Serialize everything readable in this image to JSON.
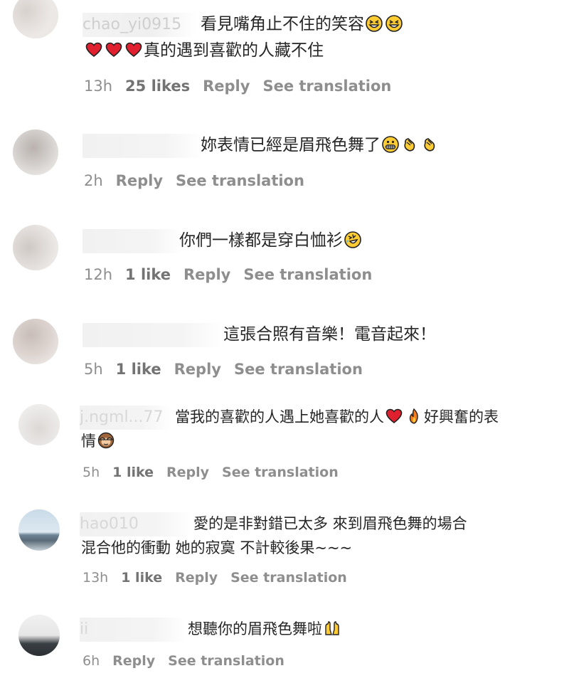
{
  "comments": [
    {
      "username": "chao_yi0915",
      "line1": "看見嘴角止不住的笑容",
      "line2": "真的遇到喜歡的人藏不住",
      "time": "13h",
      "likes": "25 likes",
      "reply": "Reply",
      "translate": "See translation"
    },
    {
      "username": "",
      "line1": "妳表情已經是眉飛色舞了",
      "time": "2h",
      "reply": "Reply",
      "translate": "See translation"
    },
    {
      "username": "",
      "line1": "你們一樣都是穿白恤衫",
      "time": "12h",
      "likes": "1 like",
      "reply": "Reply",
      "translate": "See translation"
    },
    {
      "username": "",
      "line1": "這張合照有音樂！電音起來！",
      "time": "5h",
      "likes": "1 like",
      "reply": "Reply",
      "translate": "See translation"
    },
    {
      "username": "j.ngml...77",
      "line1a": "當我的喜歡的人遇上她喜歡的人",
      "line1b": "好興奮的表",
      "line2": "情",
      "time": "5h",
      "likes": "1 like",
      "reply": "Reply",
      "translate": "See translation"
    },
    {
      "username": "hao010",
      "line1": "愛的是非對錯已太多 來到眉飛色舞的場合",
      "line2": "混合他的衝動 她的寂寞 不計較後果~~~",
      "time": "13h",
      "likes": "1 like",
      "reply": "Reply",
      "translate": "See translation"
    },
    {
      "username": "ii",
      "line1": "想聽你的眉飛色舞啦",
      "time": "6h",
      "reply": "Reply",
      "translate": "See translation"
    }
  ],
  "icons": {
    "heart": "red-heart-icon",
    "squint": "grinning-squinting-face-icon",
    "grimace": "grimacing-face-icon",
    "clap": "clapping-hands-icon",
    "rofl": "rolling-on-the-floor-laughing-icon",
    "fire": "fire-icon",
    "monkey": "see-no-evil-monkey-icon",
    "raise": "raising-hands-icon"
  },
  "colors": {
    "text": "#262626",
    "meta": "#8e8e8e",
    "heart": "#e0202e",
    "emoji_yellow": "#ffcc33"
  }
}
